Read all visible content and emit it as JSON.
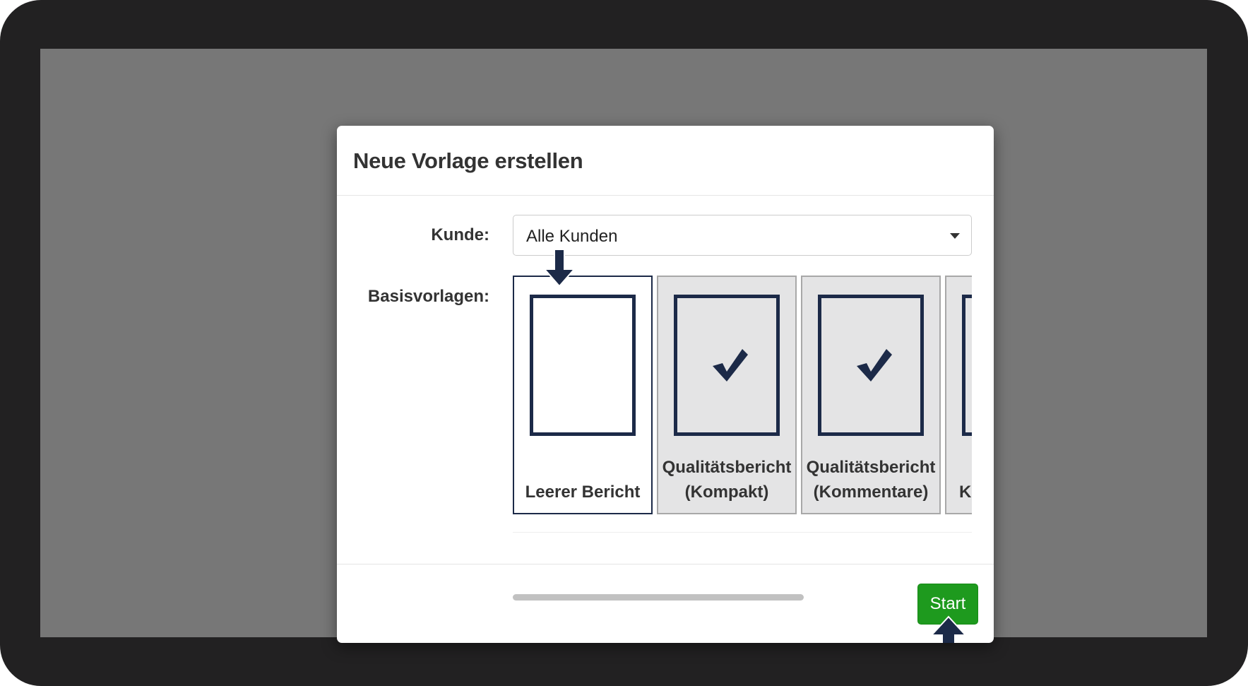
{
  "modal": {
    "title": "Neue Vorlage erstellen",
    "customer_label": "Kunde:",
    "customer_value": "Alle Kunden",
    "templates_label": "Basisvorlagen:",
    "templates": [
      {
        "label_line1": "",
        "label_line2": "Leerer Bericht",
        "thumbnail": "blank-page",
        "selected": true
      },
      {
        "label_line1": "Qualitätsbericht",
        "label_line2": "(Kompakt)",
        "thumbnail": "checkmark-page",
        "selected": false
      },
      {
        "label_line1": "Qualitätsbericht",
        "label_line2": "(Kommentare)",
        "thumbnail": "checkmark-page",
        "selected": false
      },
      {
        "label_line1": "",
        "label_line2": "K",
        "thumbnail": "page-partial",
        "selected": false
      }
    ],
    "start_label": "Start"
  },
  "colors": {
    "bezel": "#222122",
    "overlay": "#777777",
    "accent_navy": "#1c2a48",
    "start_green": "#1e9a1e"
  },
  "annotations": {
    "arrow_down": "down-arrow-icon",
    "arrow_up": "up-arrow-icon"
  }
}
